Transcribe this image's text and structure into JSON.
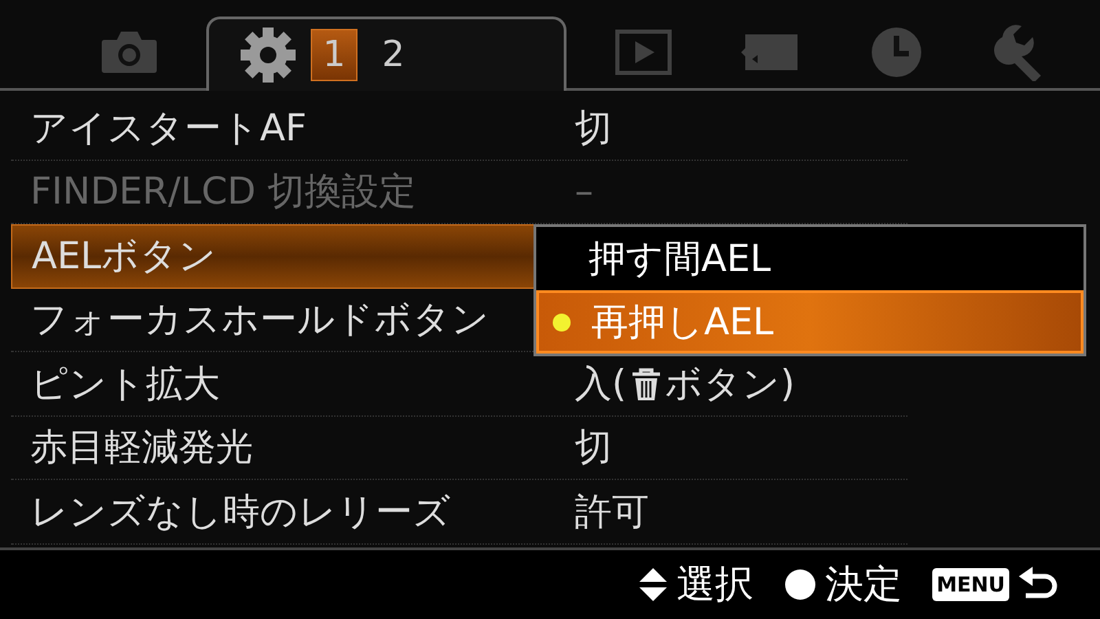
{
  "tabs": [
    {
      "kind": "camera",
      "selected": false
    },
    {
      "kind": "gear",
      "selected": true,
      "pages": [
        {
          "label": "1",
          "selected": true
        },
        {
          "label": "2",
          "selected": false
        }
      ]
    },
    {
      "kind": "play",
      "selected": false
    },
    {
      "kind": "card",
      "selected": false
    },
    {
      "kind": "clock",
      "selected": false
    },
    {
      "kind": "wrench",
      "selected": false
    }
  ],
  "rows": [
    {
      "label": "アイスタートAF",
      "value": [
        {
          "kind": "text",
          "text": "切"
        }
      ],
      "disabled": false,
      "selected": false
    },
    {
      "label": "FINDER/LCD 切換設定",
      "value": [
        {
          "kind": "text",
          "text": "–"
        }
      ],
      "disabled": true,
      "selected": false
    },
    {
      "label": "AELボタン",
      "disabled": false,
      "selected": true
    },
    {
      "label": "フォーカスホールドボタン",
      "disabled": false,
      "selected": false
    },
    {
      "label": "ピント拡大",
      "value": [
        {
          "kind": "text",
          "text": "入("
        },
        {
          "kind": "trash"
        },
        {
          "kind": "text",
          "text": "ボタン)"
        }
      ],
      "disabled": false,
      "selected": false
    },
    {
      "label": "赤目軽減発光",
      "value": [
        {
          "kind": "text",
          "text": "切"
        }
      ],
      "disabled": false,
      "selected": false
    },
    {
      "label": "レンズなし時のレリーズ",
      "value": [
        {
          "kind": "text",
          "text": "許可"
        }
      ],
      "disabled": false,
      "selected": false
    }
  ],
  "dropdown": {
    "options": [
      {
        "label": "押す間AEL",
        "selected": false
      },
      {
        "label": "再押しAEL",
        "selected": true
      }
    ]
  },
  "footer": [
    {
      "kind": "updown",
      "label": "選択"
    },
    {
      "kind": "dot",
      "label": "決定"
    },
    {
      "kind": "menu",
      "label": "MENU"
    }
  ]
}
